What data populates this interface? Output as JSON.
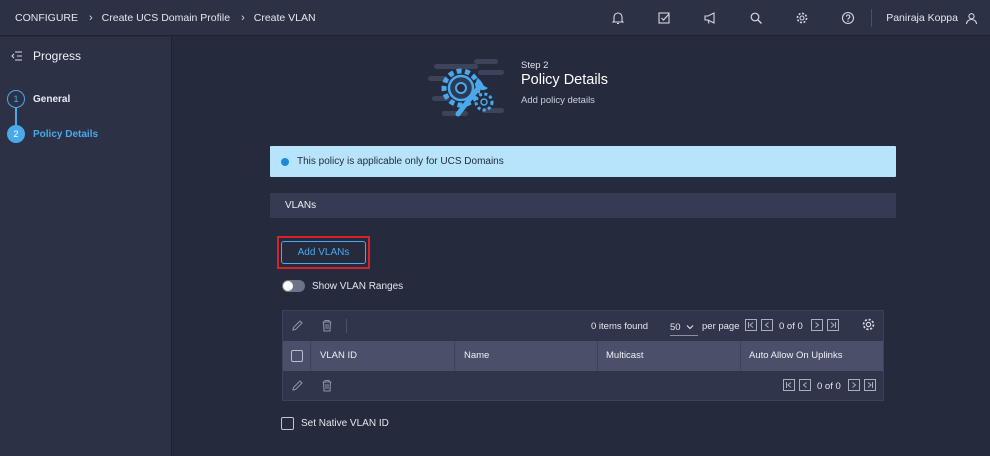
{
  "breadcrumb": {
    "items": [
      "CONFIGURE",
      "Create UCS Domain Profile",
      "Create VLAN"
    ]
  },
  "topbar": {
    "icons": [
      "bell-icon",
      "checklist-icon",
      "megaphone-icon",
      "search-icon",
      "gear-icon",
      "help-icon"
    ],
    "user_name": "Paniraja Koppa"
  },
  "sidebar": {
    "title": "Progress",
    "steps": [
      {
        "number": "1",
        "label": "General",
        "state": "completed"
      },
      {
        "number": "2",
        "label": "Policy Details",
        "state": "active"
      }
    ]
  },
  "header": {
    "step_label": "Step 2",
    "title": "Policy Details",
    "subtitle": "Add policy details"
  },
  "banner": {
    "text": "This policy is applicable only for UCS Domains"
  },
  "section": {
    "title": "VLANs"
  },
  "actions": {
    "add_vlans_label": "Add VLANs"
  },
  "toggle": {
    "label": "Show VLAN Ranges",
    "on": false
  },
  "table": {
    "items_found": "0 items found",
    "per_page_value": "50",
    "per_page_label": "per page",
    "page_info": "0 of 0",
    "columns": [
      "VLAN ID",
      "Name",
      "Multicast",
      "Auto Allow On Uplinks"
    ],
    "rows": []
  },
  "native_vlan": {
    "label": "Set Native VLAN ID",
    "checked": false
  },
  "colors": {
    "accent": "#49a9ea",
    "highlight_border": "#d8222a",
    "banner_bg": "#b8e4fb",
    "page_bg": "#252a3d"
  }
}
